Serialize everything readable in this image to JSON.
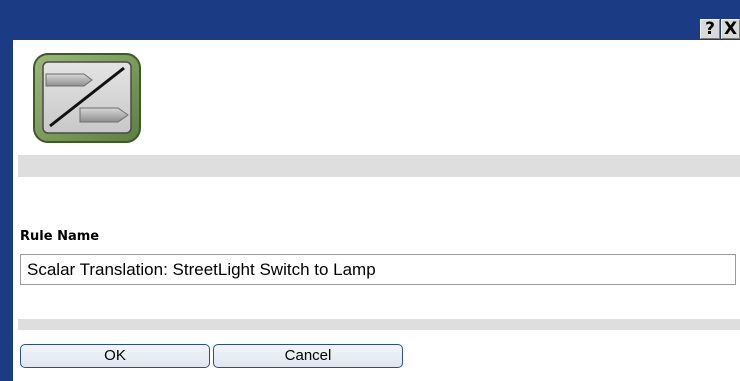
{
  "titlebar": {
    "help_label": "?",
    "close_label": "X"
  },
  "form": {
    "rule_name_label": "Rule Name",
    "rule_name_value": "Scalar Translation: StreetLight Switch to Lamp"
  },
  "buttons": {
    "ok_label": "OK",
    "cancel_label": "Cancel"
  },
  "colors": {
    "titlebar": "#1b3b84",
    "icon_frame": "#7fa05e",
    "band": "#dedede"
  },
  "icons": {
    "rule": "scalar-translation-rule-icon"
  }
}
